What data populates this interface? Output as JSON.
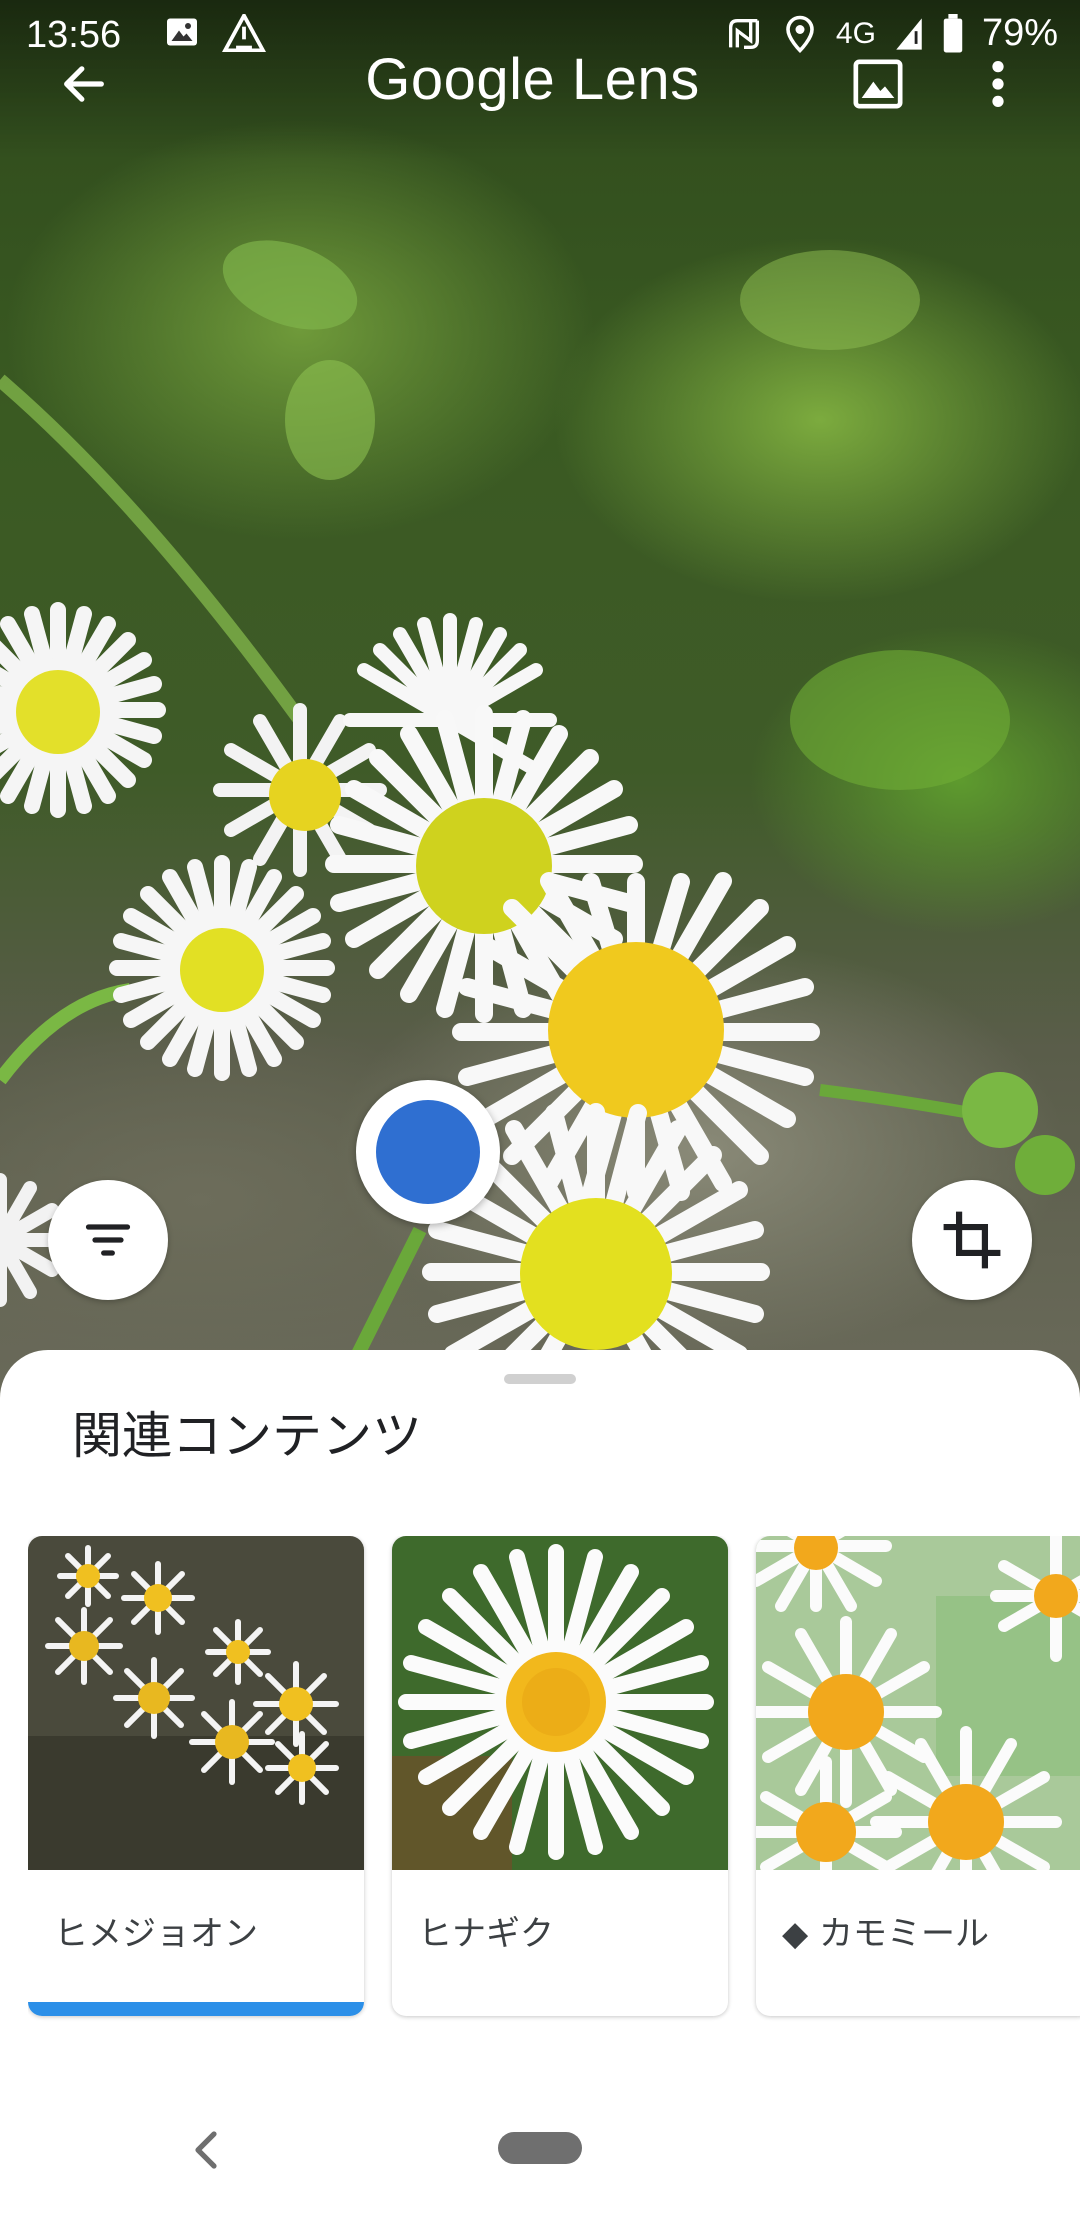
{
  "status_bar": {
    "time": "13:56",
    "network": "4G",
    "battery": "79%",
    "left_icons": [
      "image-icon",
      "warning-triangle-icon"
    ],
    "right_icons": [
      "nfc-icon",
      "location-icon",
      "signal-icon",
      "battery-icon"
    ]
  },
  "app_bar": {
    "title": "Google Lens",
    "back_icon": "arrow-back-icon",
    "gallery_icon": "image-gallery-icon",
    "more_icon": "more-vert-icon"
  },
  "controls": {
    "filter_icon": "filter-icon",
    "crop_icon": "crop-icon",
    "shutter_color": "#2f6fd1"
  },
  "results": {
    "title": "関連コンテンツ",
    "cards": [
      {
        "label": "ヒメジョオン",
        "selected": true
      },
      {
        "label": "ヒナギク",
        "selected": false
      },
      {
        "label": "◆ カモミール",
        "selected": false
      }
    ],
    "accent_color": "#2b8fe8"
  },
  "nav_bar": {
    "back_icon": "nav-back-icon",
    "home_icon": "home-pill-icon"
  }
}
